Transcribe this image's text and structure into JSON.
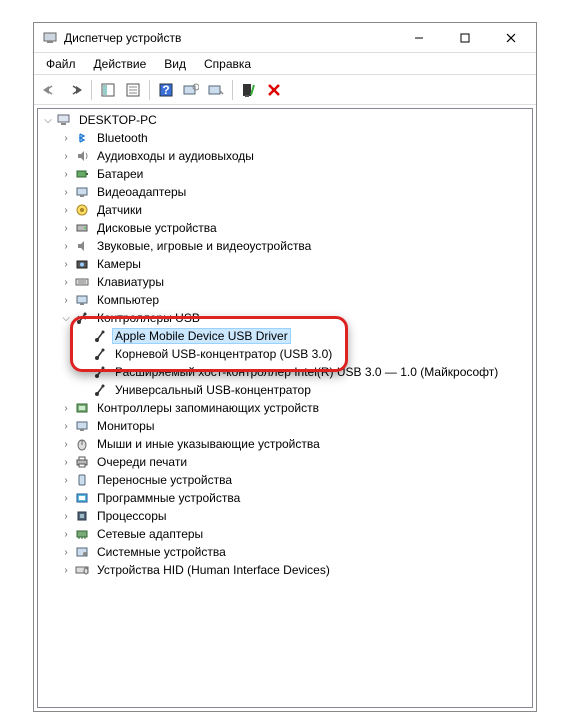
{
  "window": {
    "title": "Диспетчер устройств"
  },
  "menu": {
    "file": "Файл",
    "action": "Действие",
    "view": "Вид",
    "help": "Справка"
  },
  "root": {
    "label": "DESKTOP-PC"
  },
  "cats": {
    "bluetooth": "Bluetooth",
    "audio": "Аудиовходы и аудиовыходы",
    "battery": "Батареи",
    "videoAdapters": "Видеоадаптеры",
    "sensors": "Датчики",
    "disk": "Дисковые устройства",
    "soundVideoGame": "Звуковые, игровые и видеоустройства",
    "cameras": "Камеры",
    "keyboards": "Клавиатуры",
    "computer": "Компьютер",
    "usbControllers": "Контроллеры USB",
    "storageControllers": "Контроллеры запоминающих устройств",
    "monitors": "Мониторы",
    "mice": "Мыши и иные указывающие устройства",
    "printQueues": "Очереди печати",
    "portable": "Переносные устройства",
    "software": "Программные устройства",
    "processors": "Процессоры",
    "network": "Сетевые адаптеры",
    "system": "Системные устройства",
    "hid": "Устройства HID (Human Interface Devices)"
  },
  "usb": {
    "apple": "Apple Mobile Device USB Driver",
    "rootHub": "Корневой USB-концентратор (USB 3.0)",
    "xhci": "Расширяемый хост-контроллер Intel(R) USB 3.0 — 1.0 (Майкрософт)",
    "generic": "Универсальный USB-концентратор"
  }
}
